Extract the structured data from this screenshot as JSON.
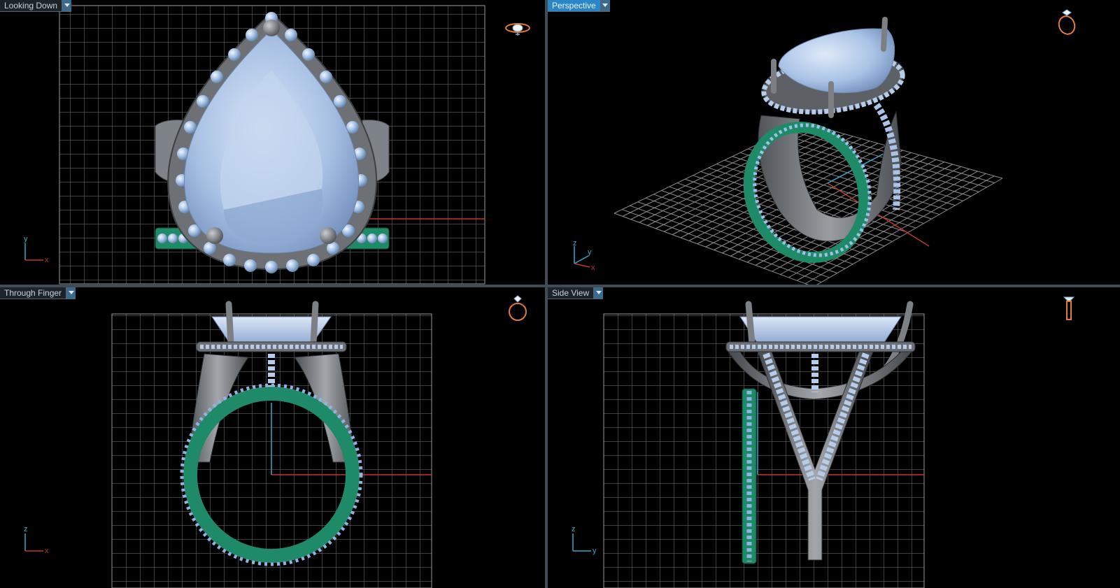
{
  "viewports": {
    "top_left": {
      "title": "Looking Down",
      "axis_v": "y",
      "axis_h": "x"
    },
    "top_right": {
      "title": "Perspective",
      "axis_z": "z",
      "axis_y": "y",
      "axis_x": "x"
    },
    "bottom_left": {
      "title": "Through Finger",
      "axis_v": "z",
      "axis_h": "x"
    },
    "bottom_right": {
      "title": "Side View",
      "axis_v": "z",
      "axis_h": "y"
    }
  },
  "colors": {
    "background": "#000000",
    "grid": "#8a8a8a",
    "active_tab": "#2a86c8",
    "gem": "#a9c3e6",
    "metal": "#6d7074",
    "band": "#1f8a67",
    "x_axis": "#c0392b",
    "y_axis": "#3aa7c8"
  }
}
